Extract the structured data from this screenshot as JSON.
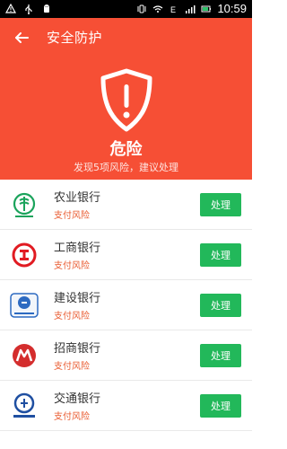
{
  "status_bar": {
    "time": "10:59"
  },
  "header": {
    "title": "安全防护",
    "status": "危险",
    "subtitle": "发现5项风险，建议处理"
  },
  "list": {
    "items": [
      {
        "name": "农业银行",
        "risk": "支付风险",
        "action": "处理",
        "logo": "abc-logo"
      },
      {
        "name": "工商银行",
        "risk": "支付风险",
        "action": "处理",
        "logo": "icbc-logo"
      },
      {
        "name": "建设银行",
        "risk": "支付风险",
        "action": "处理",
        "logo": "ccb-logo"
      },
      {
        "name": "招商银行",
        "risk": "支付风险",
        "action": "处理",
        "logo": "cmb-logo"
      },
      {
        "name": "交通银行",
        "risk": "支付风险",
        "action": "处理",
        "logo": "bocom-logo"
      }
    ]
  },
  "colors": {
    "hero": "#f64f35",
    "action_button": "#22b85a",
    "risk_text": "#e95a2f"
  }
}
